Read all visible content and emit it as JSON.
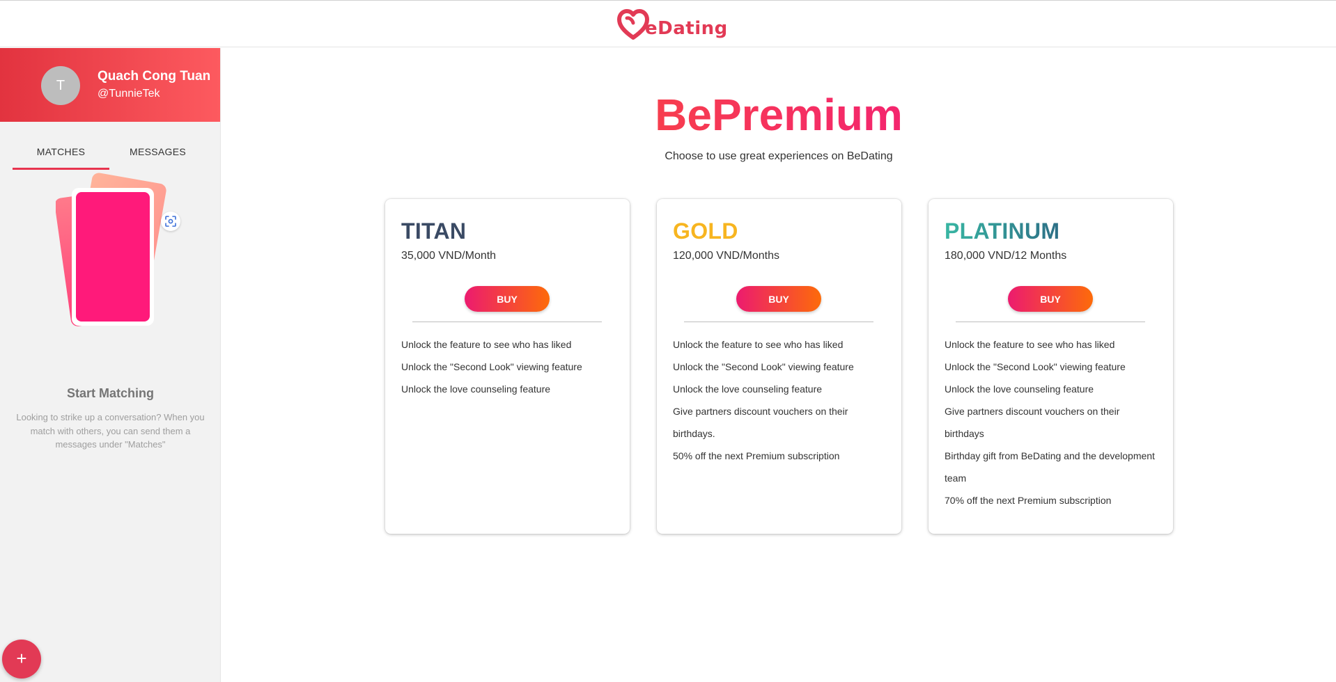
{
  "header": {
    "logo_text": "eDating",
    "brand_color": "#e23a55"
  },
  "sidebar": {
    "profile": {
      "avatar_initial": "T",
      "name": "Quach Cong Tuan",
      "handle": "@TunnieTek"
    },
    "tabs": [
      {
        "label": "MATCHES",
        "active": true
      },
      {
        "label": "MESSAGES",
        "active": false
      }
    ],
    "scan_icon": "scan-icon",
    "empty_state": {
      "title": "Start Matching",
      "description": "Looking to strike up a conversation? When you match with others, you can send them a messages under \"Matches\""
    },
    "fab_label": "+"
  },
  "main": {
    "title": "BePremium",
    "subtitle": "Choose to use great experiences on BeDating",
    "plans": [
      {
        "name": "TITAN",
        "price": "35,000 VND/Month",
        "button": "BUY",
        "features": [
          "Unlock the feature to see who has liked",
          "Unlock the \"Second Look\" viewing feature",
          "Unlock the love counseling feature"
        ]
      },
      {
        "name": "GOLD",
        "price": "120,000 VND/Months",
        "button": "BUY",
        "features": [
          "Unlock the feature to see who has liked",
          "Unlock the \"Second Look\" viewing feature",
          "Unlock the love counseling feature",
          "Give partners discount vouchers on their birthdays.",
          "50% off the next Premium subscription"
        ]
      },
      {
        "name": "PLATINUM",
        "price": "180,000 VND/12 Months",
        "button": "BUY",
        "features": [
          "Unlock the feature to see who has liked",
          "Unlock the \"Second Look\" viewing feature",
          "Unlock the love counseling feature",
          "Give partners discount vouchers on their birthdays",
          "Birthday gift from BeDating and the development team",
          "70% off the next Premium subscription"
        ]
      }
    ]
  }
}
